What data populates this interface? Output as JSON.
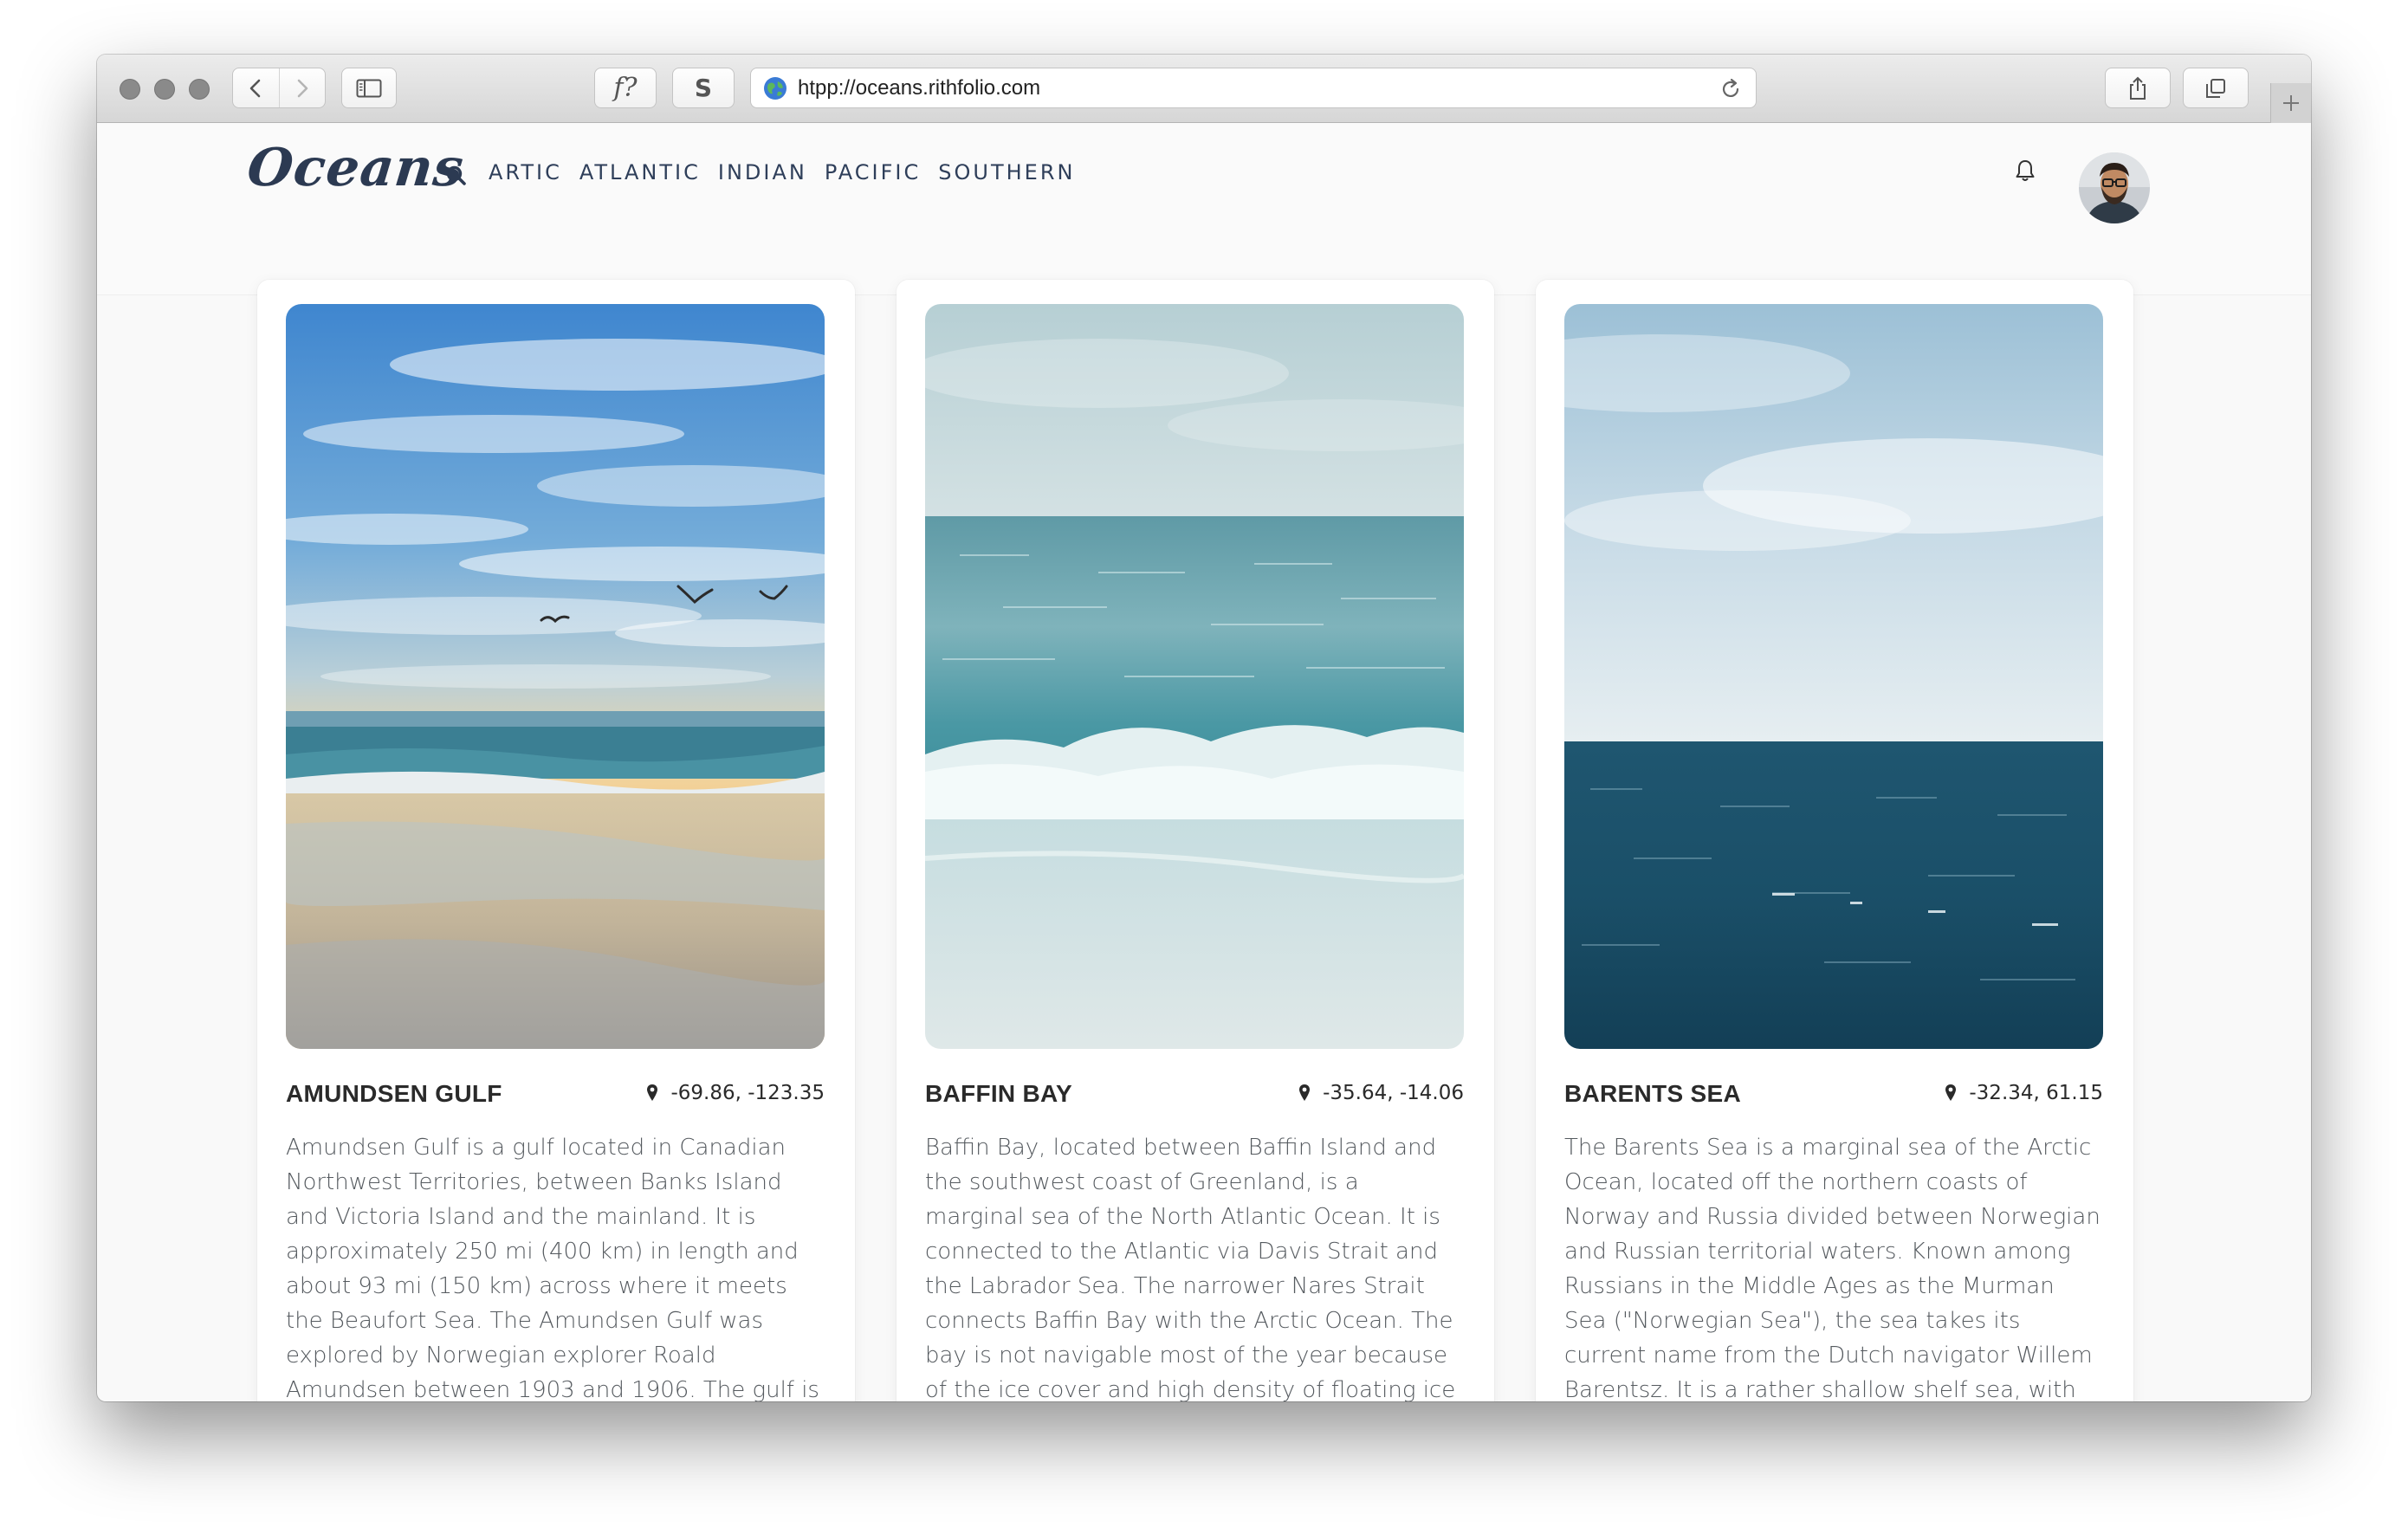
{
  "browser": {
    "url": "htpp://oceans.rithfolio.com",
    "formula_button_label": "f?",
    "s_button_label": "S"
  },
  "site": {
    "logo": "Oceans",
    "nav": [
      "ARTIC",
      "ATLANTIC",
      "INDIAN",
      "PACIFIC",
      "SOUTHERN"
    ]
  },
  "cards": [
    {
      "title": "AMUNDSEN GULF",
      "coords": "-69.86, -123.35",
      "image": "sunset-beach-with-seagulls",
      "description": "Amundsen Gulf is a gulf located in Canadian Northwest Territories, between Banks Island and Victoria Island and the mainland. It is approximately 250 mi (400 km) in length and about 93 mi (150 km) across where it meets the Beaufort Sea. The Amundsen Gulf was explored by Norwegian explorer Roald Amundsen between 1903 and 1906. The gulf is at the"
    },
    {
      "title": "BAFFIN BAY",
      "coords": "-35.64, -14.06",
      "image": "turquoise-breaking-wave",
      "description": "Baffin Bay, located between Baffin Island and the southwest coast of Greenland, is a marginal sea of the North Atlantic Ocean. It is connected to the Atlantic via Davis Strait and the Labrador Sea. The narrower Nares Strait connects Baffin Bay with the Arctic Ocean. The bay is not navigable most of the year because of the ice cover and high density of floating ice and"
    },
    {
      "title": "BARENTS SEA",
      "coords": "-32.34, 61.15",
      "image": "deep-blue-open-sea",
      "description": "The Barents Sea is a marginal sea of the Arctic Ocean, located off the northern coasts of Norway and Russia divided between Norwegian and Russian territorial waters. Known among Russians in the Middle Ages as the Murman Sea (\"Norwegian Sea\"), the sea takes its current name from the Dutch navigator Willem Barentsz. It is a rather shallow shelf sea, with an average"
    }
  ]
}
